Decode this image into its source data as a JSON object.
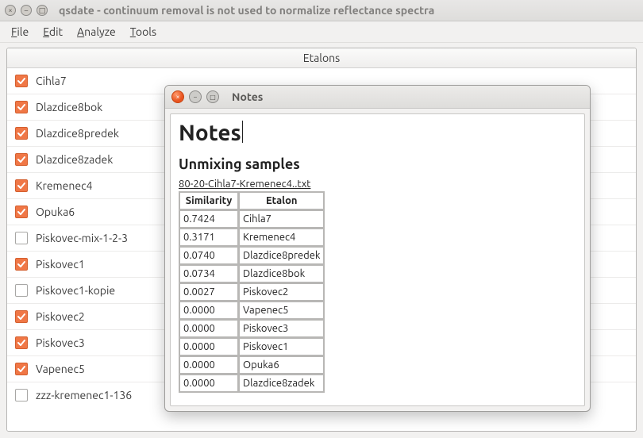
{
  "window": {
    "title": "qsdate - continuum removal is not used to normalize reflectance spectra"
  },
  "menu": {
    "items": [
      {
        "label": "File",
        "mn": "F",
        "rest": "ile"
      },
      {
        "label": "Edit",
        "mn": "E",
        "rest": "dit"
      },
      {
        "label": "Analyze",
        "mn": "A",
        "rest": "nalyze"
      },
      {
        "label": "Tools",
        "mn": "T",
        "rest": "ools"
      }
    ]
  },
  "etalons": {
    "heading": "Etalons",
    "items": [
      {
        "label": "Cihla7",
        "checked": true
      },
      {
        "label": "Dlazdice8bok",
        "checked": true
      },
      {
        "label": "Dlazdice8predek",
        "checked": true
      },
      {
        "label": "Dlazdice8zadek",
        "checked": true
      },
      {
        "label": "Kremenec4",
        "checked": true
      },
      {
        "label": "Opuka6",
        "checked": true
      },
      {
        "label": "Piskovec-mix-1-2-3",
        "checked": false
      },
      {
        "label": "Piskovec1",
        "checked": true
      },
      {
        "label": "Piskovec1-kopie",
        "checked": false
      },
      {
        "label": "Piskovec2",
        "checked": true
      },
      {
        "label": "Piskovec3",
        "checked": true
      },
      {
        "label": "Vapenec5",
        "checked": true
      },
      {
        "label": "zzz-kremenec1-136",
        "checked": false
      }
    ]
  },
  "notes": {
    "window_title": "Notes",
    "h1": "Notes",
    "h2": "Unmixing samples",
    "caption": "80-20-Cihla7-Kremenec4..txt",
    "columns": {
      "sim": "Similarity",
      "etalon": "Etalon"
    },
    "rows": [
      {
        "sim": "0.7424",
        "etalon": "Cihla7"
      },
      {
        "sim": "0.3171",
        "etalon": "Kremenec4"
      },
      {
        "sim": "0.0740",
        "etalon": "Dlazdice8predek"
      },
      {
        "sim": "0.0734",
        "etalon": "Dlazdice8bok"
      },
      {
        "sim": "0.0027",
        "etalon": "Piskovec2"
      },
      {
        "sim": "0.0000",
        "etalon": "Vapenec5"
      },
      {
        "sim": "0.0000",
        "etalon": "Piskovec3"
      },
      {
        "sim": "0.0000",
        "etalon": "Piskovec1"
      },
      {
        "sim": "0.0000",
        "etalon": "Opuka6"
      },
      {
        "sim": "0.0000",
        "etalon": "Dlazdice8zadek"
      }
    ]
  }
}
